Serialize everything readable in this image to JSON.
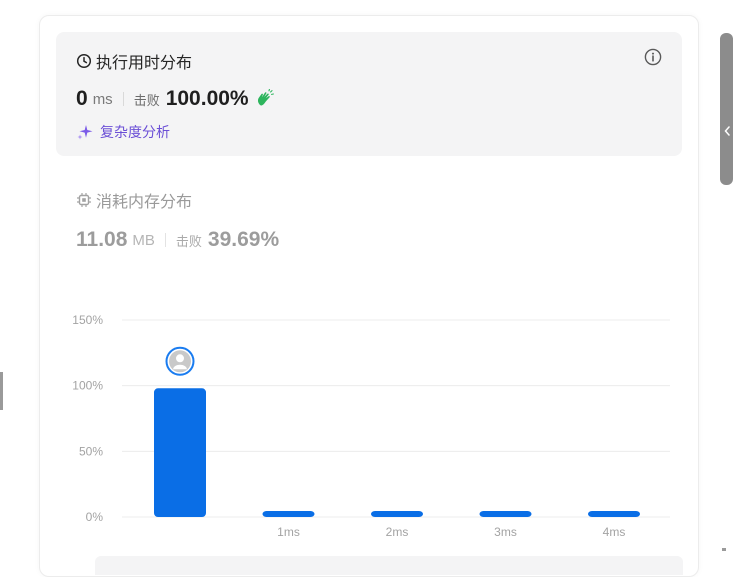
{
  "runtime": {
    "title": "执行用时分布",
    "value": "0",
    "unit": "ms",
    "beat_label": "击败",
    "beat_value": "100.00%",
    "complexity_link": "复杂度分析"
  },
  "memory": {
    "title": "消耗内存分布",
    "value": "11.08",
    "unit": "MB",
    "beat_label": "击败",
    "beat_value": "39.69%"
  },
  "colors": {
    "bar": "#0a6ee6",
    "accent_purple": "#6b4fd6",
    "wave_green": "#2db55d",
    "avatar_ring": "#1a7cf0"
  },
  "icons": [
    "clock-icon",
    "info-icon",
    "wave-hand-icon",
    "sparkle-icon",
    "chip-icon",
    "avatar-icon"
  ],
  "chart_data": {
    "type": "bar",
    "categories": [
      "",
      "1ms",
      "2ms",
      "3ms",
      "4ms"
    ],
    "values": [
      98,
      3,
      3,
      3,
      3
    ],
    "y_ticks": [
      "0%",
      "50%",
      "100%",
      "150%"
    ],
    "ylim": [
      0,
      150
    ],
    "grid": true,
    "highlight_index": 0
  }
}
